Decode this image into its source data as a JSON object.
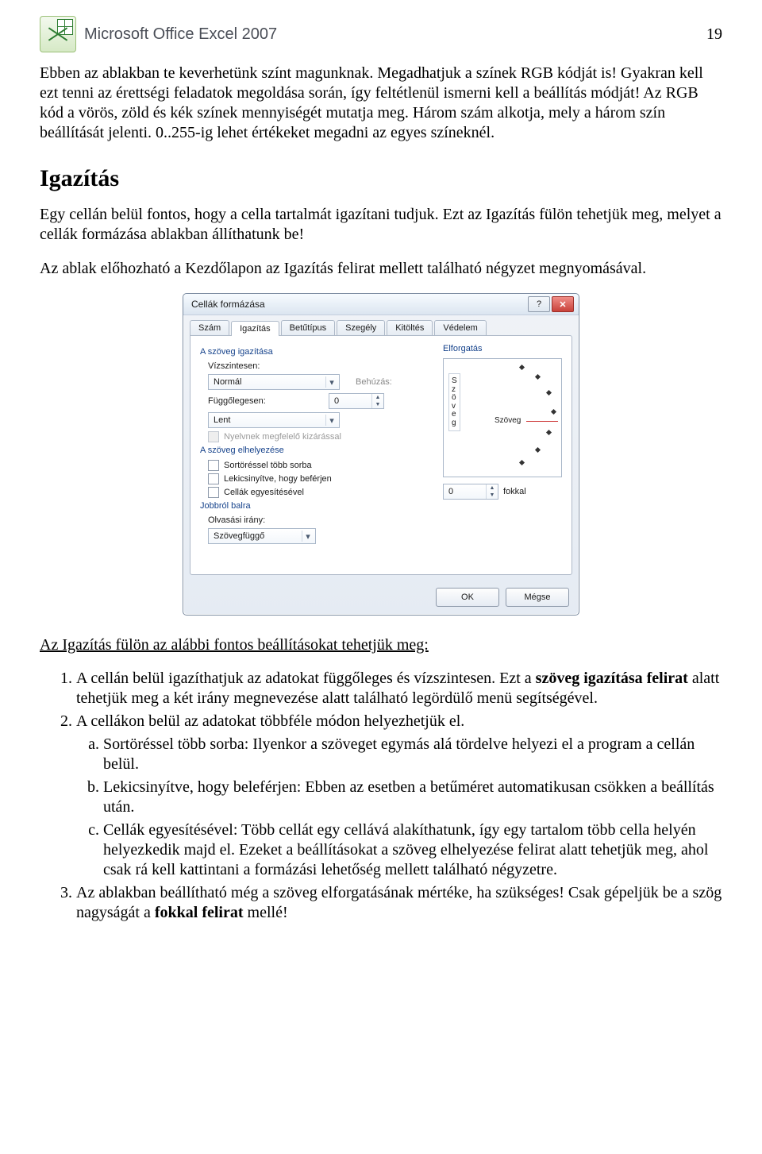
{
  "page_number": "19",
  "app_title": "Microsoft Office Excel 2007",
  "paragraphs": {
    "p1": "Ebben az ablakban te keverhetünk színt magunknak. Megadhatjuk a színek RGB kódját is! Gyakran kell ezt tenni az érettségi feladatok megoldása során, így feltétlenül ismerni kell a beállítás módját! Az RGB kód a vörös, zöld és kék színek mennyiségét mutatja meg. Három szám alkotja, mely a három szín beállítását jelenti. 0..255-ig lehet értékeket megadni az egyes színeknél.",
    "h2": "Igazítás",
    "p2": "Egy cellán belül fontos, hogy a cella tartalmát igazítani tudjuk. Ezt az Igazítás fülön tehetjük meg, melyet a cellák formázása ablakban állíthatunk be!",
    "p3": "Az ablak előhozható a Kezdőlapon az Igazítás felirat mellett található négyzet megnyomásával.",
    "underline": "Az Igazítás fülön az alábbi fontos beállításokat tehetjük meg:"
  },
  "list": {
    "li1a": "A cellán belül igazíthatjuk az adatokat függőleges és vízszintesen. Ezt a ",
    "li1b": "szöveg igazítása felirat",
    "li1c": " alatt tehetjük meg a két irány megnevezése alatt található legördülő menü segítségével.",
    "li2": "A cellákon belül az adatokat többféle módon helyezhetjük el.",
    "li2a": "Sortöréssel több sorba: Ilyenkor a szöveget egymás alá tördelve helyezi el a program a cellán belül.",
    "li2b": "Lekicsinyítve, hogy beleférjen: Ebben az esetben a betűméret automatikusan csökken a beállítás után.",
    "li2c": "Cellák egyesítésével: Több cellát egy cellává alakíthatunk, így egy tartalom több cella helyén helyezkedik majd el. Ezeket a beállításokat a szöveg elhelyezése felirat alatt tehetjük meg, ahol csak rá kell kattintani a formázási lehetőség mellett található négyzetre.",
    "li3a": "Az ablakban beállítható még a szöveg elforgatásának mértéke, ha szükséges! Csak gépeljük be a szög nagyságát a ",
    "li3b": "fokkal felirat",
    "li3c": " mellé!"
  },
  "dialog": {
    "title": "Cellák formázása",
    "tabs": [
      "Szám",
      "Igazítás",
      "Betűtípus",
      "Szegély",
      "Kitöltés",
      "Védelem"
    ],
    "active_tab_index": 1,
    "group_text_align": "A szöveg igazítása",
    "label_horizontal": "Vízszintesen:",
    "value_horizontal": "Normál",
    "label_indent": "Behúzás:",
    "value_indent": "0",
    "label_vertical": "Függőlegesen:",
    "value_vertical": "Lent",
    "chk_language": "Nyelvnek megfelelő kizárással",
    "group_text_placement": "A szöveg elhelyezése",
    "chk_wrap": "Sortöréssel több sorba",
    "chk_shrink": "Lekicsinyítve, hogy beférjen",
    "chk_merge": "Cellák egyesítésével",
    "group_rtl": "Jobbról balra",
    "label_direction": "Olvasási irány:",
    "value_direction": "Szövegfüggő",
    "rot_caption": "Elforgatás",
    "rot_vtext": "Szöveg",
    "rot_htext": "Szöveg",
    "rot_value": "0",
    "rot_unit": "fokkal",
    "btn_ok": "OK",
    "btn_cancel": "Mégse"
  }
}
